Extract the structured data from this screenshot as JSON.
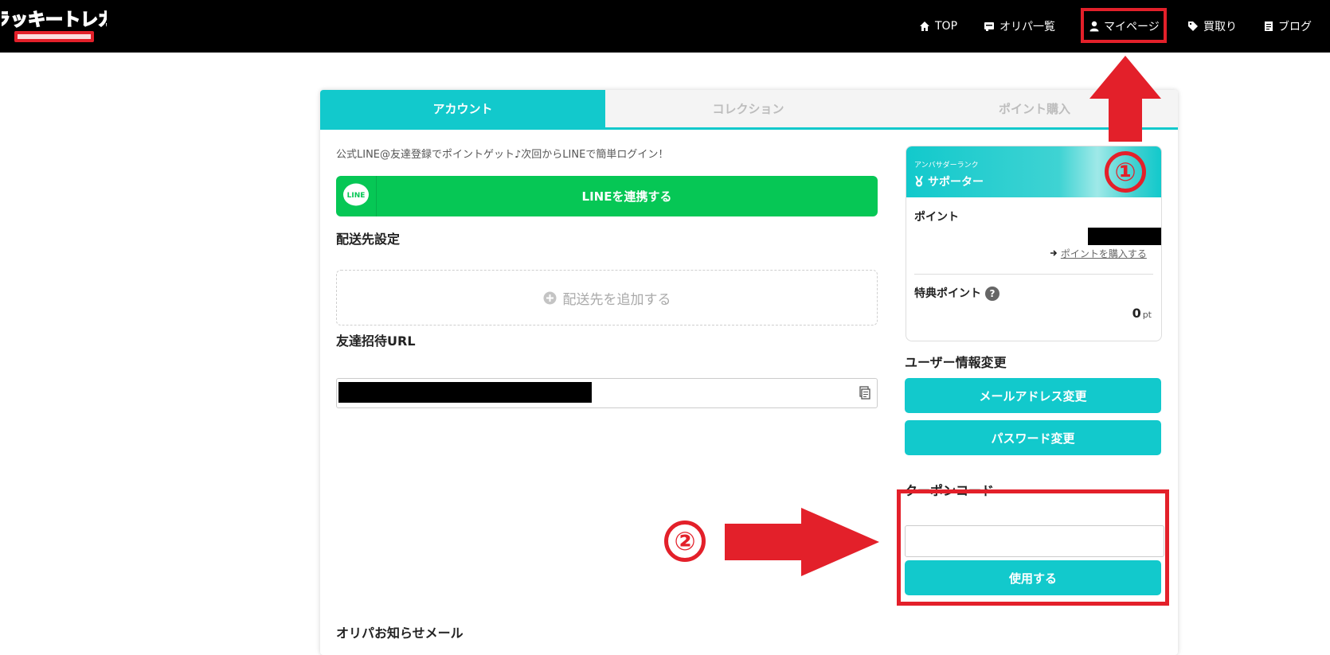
{
  "nav": {
    "items": [
      {
        "icon": "home-icon",
        "label": "TOP"
      },
      {
        "icon": "card-icon",
        "label": "オリパ一覧"
      },
      {
        "icon": "user-icon",
        "label": "マイページ"
      },
      {
        "icon": "tag-icon",
        "label": "買取り"
      },
      {
        "icon": "document-icon",
        "label": "ブログ"
      }
    ],
    "logo_alt": "ラッキートレカ"
  },
  "tabs": [
    "アカウント",
    "コレクション",
    "ポイント購入"
  ],
  "line": {
    "note": "公式LINE@友達登録でポイントゲット♪次回からLINEで簡単ログイン！",
    "logo_text": "LINE",
    "button_label": "LINEを連携する"
  },
  "shipping": {
    "title": "配送先設定",
    "add_label": "配送先を追加する"
  },
  "invite": {
    "title": "友達招待URL"
  },
  "rank": {
    "sub": "アンバサダーランク",
    "name": "サポーター",
    "points_label": "ポイント",
    "buy_link": "ポイントを購入する",
    "bonus_label": "特典ポイント",
    "bonus_value": "0",
    "bonus_unit": "pt"
  },
  "user_settings": {
    "title": "ユーザー情報変更",
    "email_button": "メールアドレス変更",
    "password_button": "パスワード変更"
  },
  "coupon": {
    "title": "クーポンコード",
    "submit": "使用する"
  },
  "oripa_mail": {
    "title": "オリパお知らせメール"
  },
  "annotations": {
    "step1": "①",
    "step2": "②",
    "color": "#e3202a"
  },
  "colors": {
    "accent": "#12c9cc",
    "line_green": "#06c755",
    "topbar": "#000000"
  }
}
